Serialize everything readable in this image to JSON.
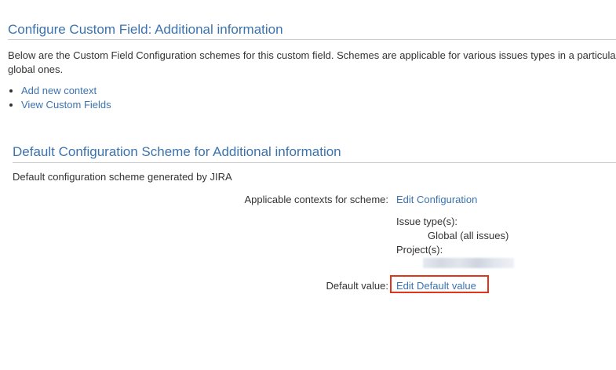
{
  "header": {
    "title": "Configure Custom Field: Additional information",
    "description": "Below are the Custom Field Configuration schemes for this custom field. Schemes are applicable for various issues types in a particula",
    "description_line2": "global ones."
  },
  "links": {
    "add_context": "Add new context",
    "view_fields": "View Custom Fields"
  },
  "scheme": {
    "title": "Default Configuration Scheme for Additional information",
    "description": "Default configuration scheme generated by JIRA",
    "contexts_label": "Applicable contexts for scheme:",
    "edit_config_link": "Edit Configuration",
    "issue_types_label": "Issue type(s):",
    "issue_types_value": "Global (all issues)",
    "projects_label": "Project(s):",
    "default_value_label": "Default value:",
    "edit_default_link": "Edit Default value"
  },
  "colors": {
    "link": "#3b73af",
    "highlight": "#e2341d"
  }
}
